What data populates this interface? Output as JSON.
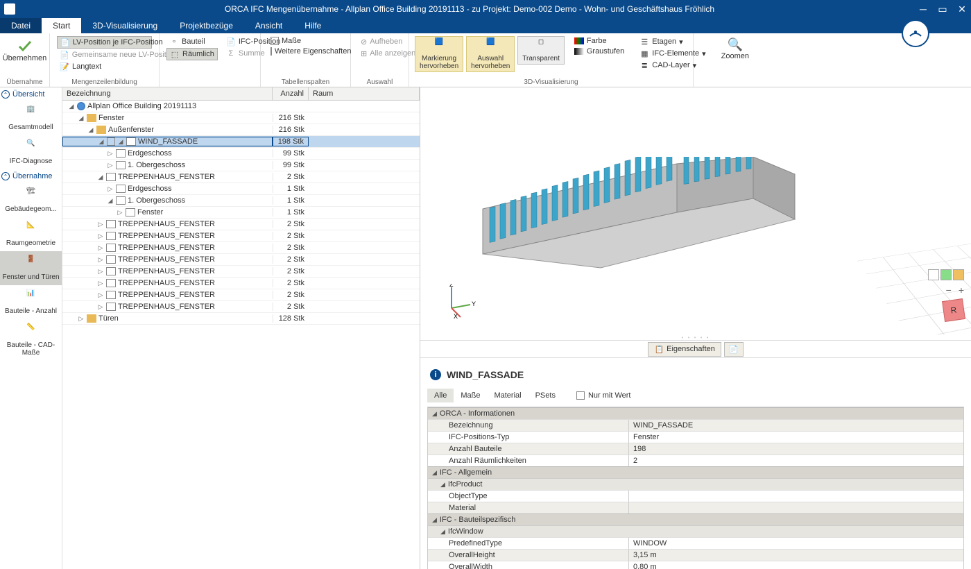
{
  "title": "ORCA IFC Mengenübernahme - Allplan Office Building 20191113 - zu Projekt: Demo-002 Demo - Wohn- und Geschäftshaus Fröhlich",
  "menu": {
    "file": "Datei",
    "start": "Start",
    "viz3d": "3D-Visualisierung",
    "proj": "Projektbezüge",
    "view": "Ansicht",
    "help": "Hilfe"
  },
  "ribbon": {
    "uebernehmen": "Übernehmen",
    "lv_pos_ifc": "LV-Position je IFC-Position",
    "gem_lv": "Gemeinsame neue LV-Position",
    "langtext": "Langtext",
    "grp_uebernahme": "Übernahme",
    "bauteil": "Bauteil",
    "raeumlich": "Räumlich",
    "ifc_position": "IFC-Position",
    "summe": "Summe",
    "grp_mengen": "Mengenzeilenbildung",
    "masse": "Maße",
    "weitere": "Weitere Eigenschaften",
    "grp_tabellen": "Tabellenspalten",
    "aufheben": "Aufheben",
    "alle_anz": "Alle anzeigen",
    "grp_auswahl": "Auswahl",
    "markierung": "Markierung hervorheben",
    "auswahl_h": "Auswahl hervorheben",
    "transparent": "Transparent",
    "farbe": "Farbe",
    "graustufen": "Graustufen",
    "etagen": "Etagen",
    "ifc_elemente": "IFC-Elemente",
    "cad_layer": "CAD-Layer",
    "zoomen": "Zoomen",
    "grp_3d": "3D-Visualisierung"
  },
  "leftnav": {
    "uebersicht": "Übersicht",
    "gesamtmodell": "Gesamtmodell",
    "ifc_diagnose": "IFC-Diagnose",
    "uebernahme": "Übernahme",
    "gebaeude": "Gebäudegeom...",
    "raum": "Raumgeometrie",
    "fenster_tueren": "Fenster und Türen",
    "bauteile_anz": "Bauteile - Anzahl",
    "bauteile_cad": "Bauteile - CAD-Maße"
  },
  "tree": {
    "h_bez": "Bezeichnung",
    "h_anz": "Anzahl",
    "h_raum": "Raum",
    "rows": [
      {
        "indent": 0,
        "open": true,
        "icon": "globe",
        "label": "Allplan Office Building 20191113",
        "qty": ""
      },
      {
        "indent": 1,
        "open": true,
        "icon": "folder",
        "label": "Fenster",
        "qty": "216 Stk"
      },
      {
        "indent": 2,
        "open": true,
        "icon": "folder",
        "label": "Außenfenster",
        "qty": "216 Stk"
      },
      {
        "indent": 3,
        "open": true,
        "icon": "doc",
        "label": "WIND_FASSADE",
        "qty": "198 Stk",
        "selected": true,
        "chk": true
      },
      {
        "indent": 4,
        "open": false,
        "icon": "grid",
        "label": "Erdgeschoss",
        "qty": "99 Stk"
      },
      {
        "indent": 4,
        "open": false,
        "icon": "grid",
        "label": "1. Obergeschoss",
        "qty": "99 Stk"
      },
      {
        "indent": 3,
        "open": true,
        "icon": "doc",
        "label": "TREPPENHAUS_FENSTER",
        "qty": "2 Stk"
      },
      {
        "indent": 4,
        "open": false,
        "icon": "grid",
        "label": "Erdgeschoss",
        "qty": "1 Stk"
      },
      {
        "indent": 4,
        "open": true,
        "icon": "grid",
        "label": "1. Obergeschoss",
        "qty": "1 Stk"
      },
      {
        "indent": 5,
        "open": false,
        "icon": "grid",
        "label": "Fenster",
        "qty": "1 Stk"
      },
      {
        "indent": 3,
        "open": false,
        "icon": "doc",
        "label": "TREPPENHAUS_FENSTER",
        "qty": "2 Stk"
      },
      {
        "indent": 3,
        "open": false,
        "icon": "doc",
        "label": "TREPPENHAUS_FENSTER",
        "qty": "2 Stk"
      },
      {
        "indent": 3,
        "open": false,
        "icon": "doc",
        "label": "TREPPENHAUS_FENSTER",
        "qty": "2 Stk"
      },
      {
        "indent": 3,
        "open": false,
        "icon": "doc",
        "label": "TREPPENHAUS_FENSTER",
        "qty": "2 Stk"
      },
      {
        "indent": 3,
        "open": false,
        "icon": "doc",
        "label": "TREPPENHAUS_FENSTER",
        "qty": "2 Stk"
      },
      {
        "indent": 3,
        "open": false,
        "icon": "doc",
        "label": "TREPPENHAUS_FENSTER",
        "qty": "2 Stk"
      },
      {
        "indent": 3,
        "open": false,
        "icon": "doc",
        "label": "TREPPENHAUS_FENSTER",
        "qty": "2 Stk"
      },
      {
        "indent": 3,
        "open": false,
        "icon": "doc",
        "label": "TREPPENHAUS_FENSTER",
        "qty": "2 Stk"
      },
      {
        "indent": 1,
        "open": false,
        "icon": "folder",
        "label": "Türen",
        "qty": "128 Stk"
      }
    ]
  },
  "axes": {
    "x": "X",
    "y": "Y",
    "z": "Z"
  },
  "rcube": "R",
  "prop": {
    "eigenschaften": "Eigenschaften",
    "title": "WIND_FASSADE",
    "tabs": {
      "alle": "Alle",
      "masse": "Maße",
      "material": "Material",
      "psets": "PSets"
    },
    "nur_wert": "Nur mit Wert",
    "groups": [
      {
        "type": "group",
        "label": "ORCA - Informationen"
      },
      {
        "type": "row",
        "key": "Bezeichnung",
        "val": "WIND_FASSADE",
        "alt": true
      },
      {
        "type": "row",
        "key": "IFC-Positions-Typ",
        "val": "Fenster"
      },
      {
        "type": "row",
        "key": "Anzahl Bauteile",
        "val": "198",
        "alt": true
      },
      {
        "type": "row",
        "key": "Anzahl Räumlichkeiten",
        "val": "2"
      },
      {
        "type": "group",
        "label": "IFC - Allgemein"
      },
      {
        "type": "sub",
        "label": "IfcProduct"
      },
      {
        "type": "row",
        "key": "ObjectType",
        "val": ""
      },
      {
        "type": "row",
        "key": "Material",
        "val": "",
        "alt": true
      },
      {
        "type": "group",
        "label": "IFC - Bauteilspezifisch"
      },
      {
        "type": "sub",
        "label": "IfcWindow"
      },
      {
        "type": "row",
        "key": "PredefinedType",
        "val": "WINDOW"
      },
      {
        "type": "row",
        "key": "OverallHeight",
        "val": "3,15 m",
        "alt": true
      },
      {
        "type": "row",
        "key": "OverallWidth",
        "val": "0,80 m"
      }
    ]
  }
}
